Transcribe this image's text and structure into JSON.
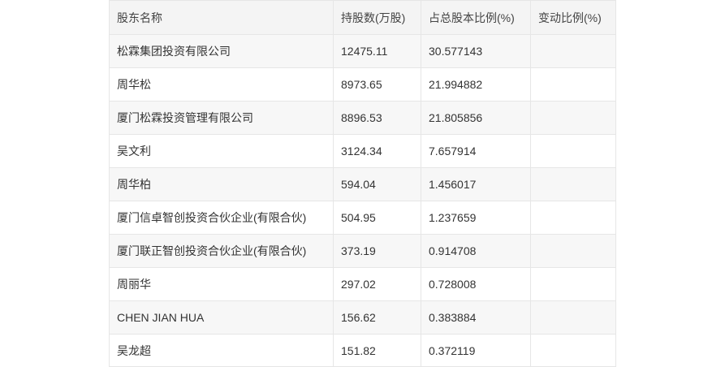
{
  "table": {
    "headers": [
      "股东名称",
      "持股数(万股)",
      "占总股本比例(%)",
      "变动比例(%)"
    ],
    "rows": [
      [
        "松霖集团投资有限公司",
        "12475.11",
        "30.577143",
        ""
      ],
      [
        "周华松",
        "8973.65",
        "21.994882",
        ""
      ],
      [
        "厦门松霖投资管理有限公司",
        "8896.53",
        "21.805856",
        ""
      ],
      [
        "吴文利",
        "3124.34",
        "7.657914",
        ""
      ],
      [
        "周华柏",
        "594.04",
        "1.456017",
        ""
      ],
      [
        "厦门信卓智创投资合伙企业(有限合伙)",
        "504.95",
        "1.237659",
        ""
      ],
      [
        "厦门联正智创投资合伙企业(有限合伙)",
        "373.19",
        "0.914708",
        ""
      ],
      [
        "周丽华",
        "297.02",
        "0.728008",
        ""
      ],
      [
        "CHEN JIAN HUA",
        "156.62",
        "0.383884",
        ""
      ],
      [
        "吴龙超",
        "151.82",
        "0.372119",
        ""
      ]
    ]
  }
}
